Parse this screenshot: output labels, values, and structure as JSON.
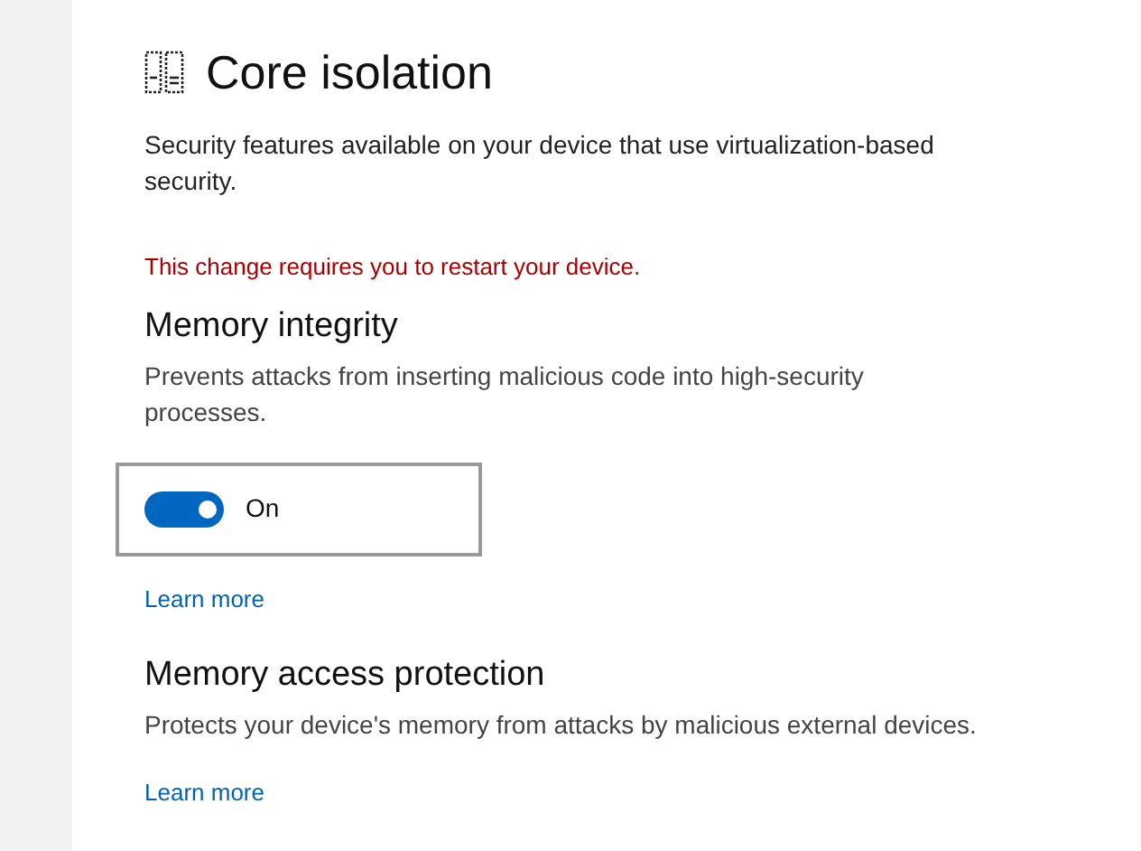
{
  "page": {
    "title": "Core isolation",
    "description": "Security features available on your device that use virtualization-based security."
  },
  "warning": "This change requires you to restart your device.",
  "sections": [
    {
      "heading": "Memory integrity",
      "description": "Prevents attacks from inserting malicious code into high-security processes.",
      "toggle": {
        "on": true,
        "label": "On"
      },
      "link": "Learn more"
    },
    {
      "heading": "Memory access protection",
      "description": "Protects your device's memory from attacks by malicious external devices.",
      "link": "Learn more"
    }
  ]
}
